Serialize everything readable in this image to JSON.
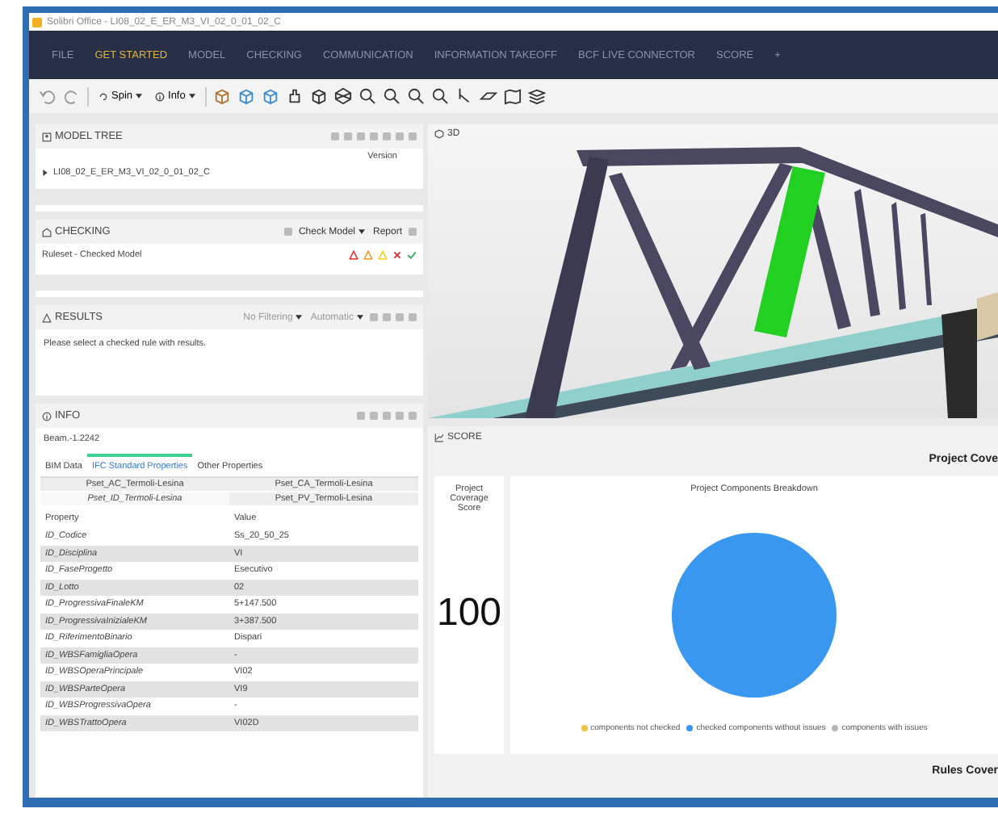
{
  "window": {
    "title": "Solibri Office - LI08_02_E_ER_M3_VI_02_0_01_02_C"
  },
  "menu_tabs": [
    {
      "label": "FILE",
      "selected": false
    },
    {
      "label": "GET STARTED",
      "selected": true
    },
    {
      "label": "MODEL",
      "selected": false
    },
    {
      "label": "CHECKING",
      "selected": false
    },
    {
      "label": "COMMUNICATION",
      "selected": false
    },
    {
      "label": "INFORMATION TAKEOFF",
      "selected": false
    },
    {
      "label": "BCF LIVE CONNECTOR",
      "selected": false
    },
    {
      "label": "SCORE",
      "selected": false
    }
  ],
  "add_tab": "+",
  "toolbar": {
    "spin": "Spin",
    "info": "Info"
  },
  "model_tree": {
    "title": "MODEL TREE",
    "column": "Version",
    "items": [
      {
        "label": "LI08_02_E_ER_M3_VI_02_0_01_02_C",
        "expanded": false
      }
    ]
  },
  "checking": {
    "title": "CHECKING",
    "check_model": "Check Model",
    "report": "Report",
    "ruleset": "Ruleset - Checked Model"
  },
  "results": {
    "title": "RESULTS",
    "filter": "No Filtering",
    "mode": "Automatic",
    "message": "Please select a checked rule with results."
  },
  "info": {
    "title": "INFO",
    "element": "Beam.-1.2242",
    "tabs": [
      {
        "label": "BIM Data",
        "selected": false
      },
      {
        "label": "IFC Standard Properties",
        "selected": true
      },
      {
        "label": "Other Properties",
        "selected": false
      }
    ],
    "psets": [
      {
        "label": "Pset_AC_Termoli-Lesina",
        "selected": false
      },
      {
        "label": "Pset_CA_Termoli-Lesina",
        "selected": false
      },
      {
        "label": "Pset_ID_Termoli-Lesina",
        "selected": true
      },
      {
        "label": "Pset_PV_Termoli-Lesina",
        "selected": false
      }
    ],
    "columns": [
      "Property",
      "Value"
    ],
    "rows": [
      {
        "property": "ID_Codice",
        "value": "Ss_20_50_25"
      },
      {
        "property": "ID_Disciplina",
        "value": "VI"
      },
      {
        "property": "ID_FaseProgetto",
        "value": "Esecutivo"
      },
      {
        "property": "ID_Lotto",
        "value": "02"
      },
      {
        "property": "ID_ProgressivaFinaleKM",
        "value": "5+147.500"
      },
      {
        "property": "ID_ProgressivaInizialeKM",
        "value": "3+387.500"
      },
      {
        "property": "ID_RiferimentoBinario",
        "value": "Dispari"
      },
      {
        "property": "ID_WBSFamigliaOpera",
        "value": "-"
      },
      {
        "property": "ID_WBSOperaPrincipale",
        "value": "VI02"
      },
      {
        "property": "ID_WBSParteOpera",
        "value": "VI9"
      },
      {
        "property": "ID_WBSProgressivaOpera",
        "value": "-"
      },
      {
        "property": "ID_WBSTrattoOpera",
        "value": "VI02D"
      }
    ]
  },
  "view_3d": {
    "title": "3D"
  },
  "score": {
    "title": "SCORE",
    "heading": "Project Cove",
    "card_label": "Project Coverage Score",
    "value": "100",
    "footer": "Rules Cover",
    "chart_data": {
      "type": "pie",
      "title": "Project Components Breakdown",
      "categories": [
        "components not checked",
        "checked components without issues",
        "components with issues"
      ],
      "values": [
        0,
        100,
        0
      ],
      "colors": [
        "#f0c040",
        "#3a97f0",
        "#b8b8b8"
      ]
    }
  }
}
